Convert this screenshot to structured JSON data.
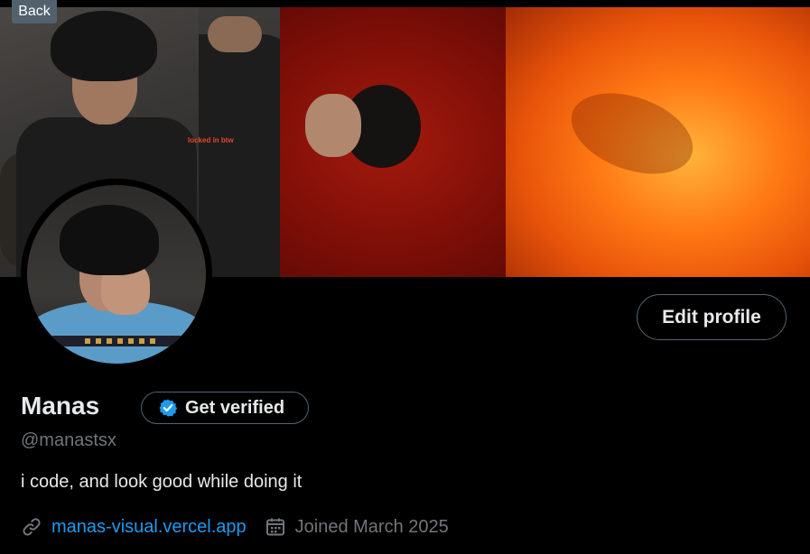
{
  "nav": {
    "back_label": "Back"
  },
  "banner": {
    "caption": "locked in btw"
  },
  "profile": {
    "edit_label": "Edit profile",
    "name": "Manas",
    "verify_label": "Get verified",
    "handle": "@manastsx",
    "bio": "i code, and look good while doing it",
    "link": "manas-visual.vercel.app",
    "joined": "Joined March 2025"
  },
  "icons": {
    "verified": "verified-badge-icon",
    "link": "link-icon",
    "calendar": "calendar-icon"
  },
  "colors": {
    "background": "#000000",
    "text": "#e7e9ea",
    "muted": "#71767b",
    "link": "#1d9bf0",
    "border": "#536471",
    "badge": "#1d9bf0"
  }
}
